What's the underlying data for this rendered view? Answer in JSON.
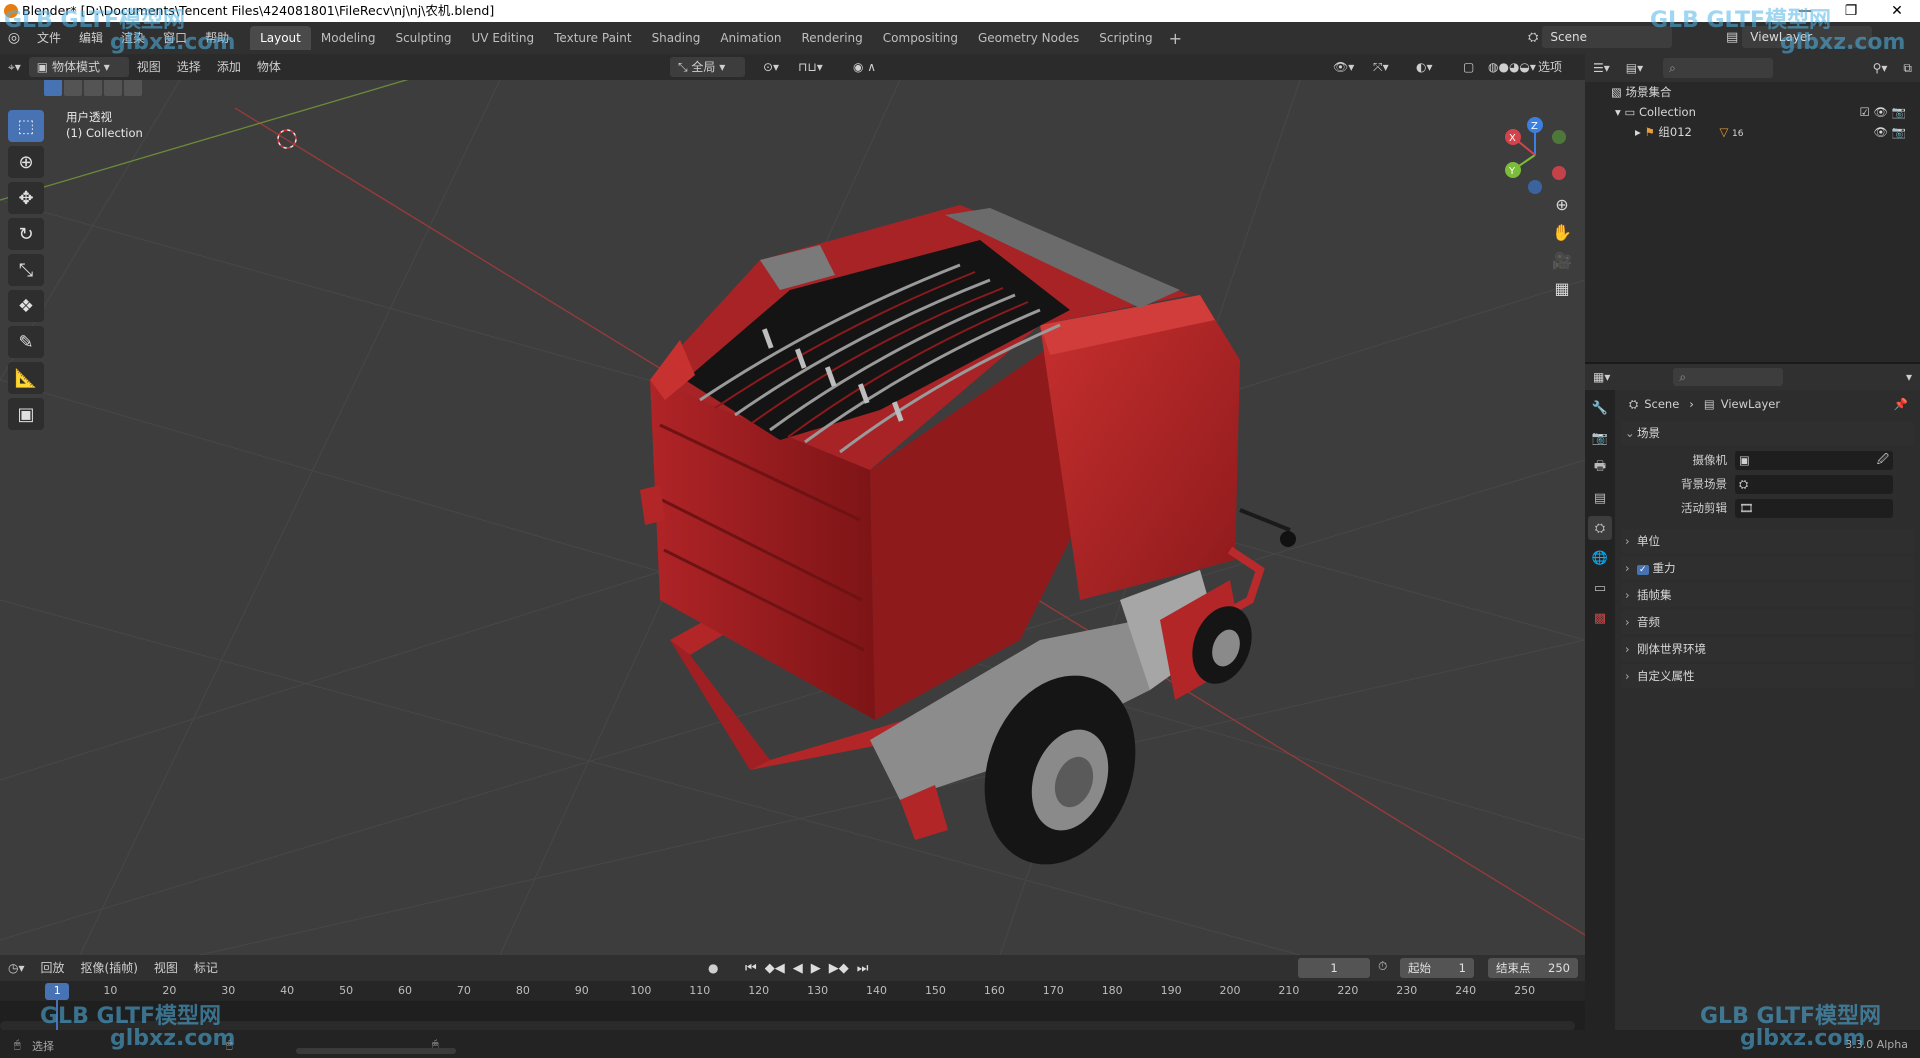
{
  "window": {
    "title": "Blender* [D:\\Documents\\Tencent Files\\424081801\\FileRecv\\nj\\nj\\农机.blend]",
    "controls": [
      "—",
      "❐",
      "✕"
    ]
  },
  "menubar": {
    "items": [
      "文件",
      "编辑",
      "渲染",
      "窗口",
      "帮助"
    ],
    "workspaces": [
      "Layout",
      "Modeling",
      "Sculpting",
      "UV Editing",
      "Texture Paint",
      "Shading",
      "Animation",
      "Rendering",
      "Compositing",
      "Geometry Nodes",
      "Scripting"
    ],
    "active_workspace": "Layout",
    "add_label": "+",
    "scene_label": "Scene",
    "viewlayer_label": "ViewLayer"
  },
  "viewport_header": {
    "mode": "物体模式",
    "menus": [
      "视图",
      "选择",
      "添加",
      "物体"
    ],
    "orientation": "全局",
    "options_label": "选项"
  },
  "viewport": {
    "view_name": "用户透视",
    "collection_label": "(1) Collection",
    "gizmo_axes": [
      "X",
      "Y",
      "Z"
    ],
    "tools": [
      "select-box",
      "cursor",
      "move",
      "rotate",
      "scale",
      "transform",
      "annotate",
      "measure",
      "add-cube"
    ]
  },
  "outliner": {
    "search_placeholder": "",
    "root": "场景集合",
    "collection": "Collection",
    "object": "组012",
    "object_badge": "16"
  },
  "properties": {
    "breadcrumb_scene": "Scene",
    "breadcrumb_layer": "ViewLayer",
    "section_title": "场景",
    "rows": [
      {
        "label": "摄像机",
        "value": ""
      },
      {
        "label": "背景场景",
        "value": ""
      },
      {
        "label": "活动剪辑",
        "value": ""
      }
    ],
    "panels": [
      "单位",
      "重力",
      "插帧集",
      "音频",
      "刚体世界环境",
      "自定义属性"
    ],
    "gravity_checked": true
  },
  "timeline": {
    "menus": [
      "回放",
      "抠像(插帧)",
      "视图",
      "标记"
    ],
    "current_frame": "1",
    "start_label": "起始",
    "start_value": "1",
    "end_label": "结束点",
    "end_value": "250",
    "ruler_marks": [
      "1",
      "10",
      "20",
      "30",
      "40",
      "50",
      "60",
      "70",
      "80",
      "90",
      "100",
      "110",
      "120",
      "130",
      "140",
      "150",
      "160",
      "170",
      "180",
      "190",
      "200",
      "210",
      "220",
      "230",
      "240",
      "250"
    ]
  },
  "statusbar": {
    "left": "选择",
    "version": "3.3.0 Alpha"
  },
  "watermark": {
    "brand": "GLB GLTF模型网",
    "url": "glbxz.com"
  },
  "colors": {
    "accent": "#4772b3",
    "viewport_bg": "#3d3d3d",
    "model_red": "#b8262a"
  }
}
